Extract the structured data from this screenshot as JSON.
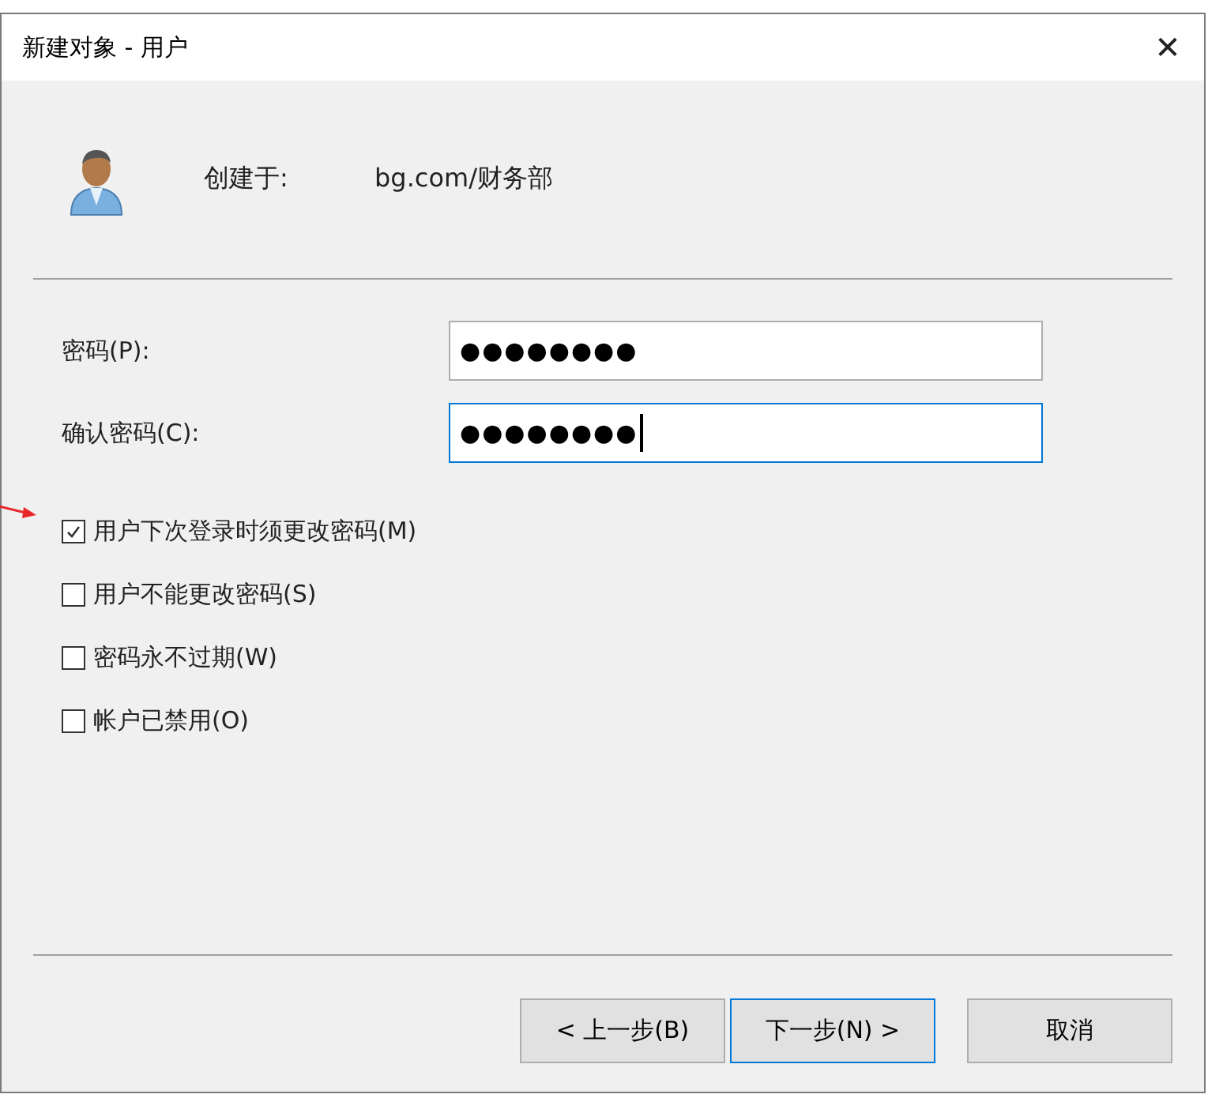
{
  "window": {
    "title": "新建对象 - 用户",
    "close": "✕"
  },
  "header": {
    "label": "创建于:",
    "value": "bg.com/财务部"
  },
  "fields": [
    {
      "label": "密码(P):",
      "value": "●●●●●●●●",
      "focused": false
    },
    {
      "label": "确认密码(C):",
      "value": "●●●●●●●●",
      "focused": true
    }
  ],
  "options": [
    {
      "label": "用户下次登录时须更改密码(M)",
      "checked": true
    },
    {
      "label": "用户不能更改密码(S)",
      "checked": false
    },
    {
      "label": "密码永不过期(W)",
      "checked": false
    },
    {
      "label": "帐户已禁用(O)",
      "checked": false
    }
  ],
  "buttons": [
    {
      "label": "< 上一步(B)",
      "default": false
    },
    {
      "label": "下一步(N) >",
      "default": true
    },
    {
      "label": "取消",
      "default": false
    }
  ]
}
